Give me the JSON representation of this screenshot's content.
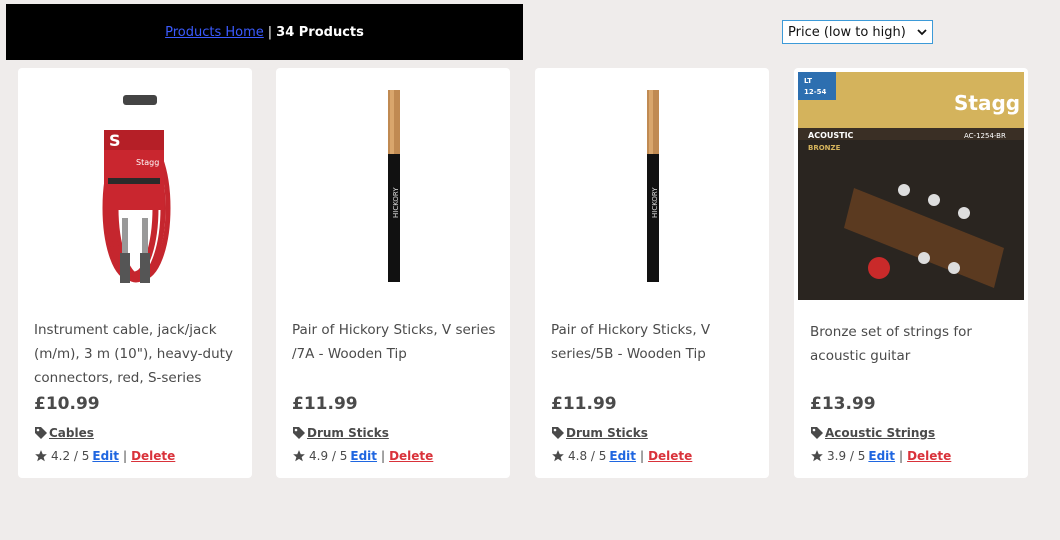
{
  "header": {
    "home_link": "Products Home",
    "separator": "|",
    "count_label": "34 Products"
  },
  "sort": {
    "selected": "Price (low to high)"
  },
  "products": [
    {
      "title": "Instrument cable, jack/jack (m/m), 3 m (10\"), heavy-duty connectors, red, S-series",
      "price": "£10.99",
      "category": "Cables",
      "rating": "4.2 / 5",
      "edit": "Edit",
      "sep": "|",
      "delete": "Delete",
      "image_icon": "red-cable-image"
    },
    {
      "title": "Pair of Hickory Sticks, V series /7A - Wooden Tip",
      "price": "£11.99",
      "category": "Drum Sticks",
      "rating": "4.9 / 5",
      "edit": "Edit",
      "sep": "|",
      "delete": "Delete",
      "image_icon": "drumstick-image"
    },
    {
      "title": "Pair of Hickory Sticks, V series/5B - Wooden Tip",
      "price": "£11.99",
      "category": "Drum Sticks",
      "rating": "4.8 / 5",
      "edit": "Edit",
      "sep": "|",
      "delete": "Delete",
      "image_icon": "drumstick-image"
    },
    {
      "title": "Bronze set of strings for acoustic guitar",
      "price": "£13.99",
      "category": "Acoustic Strings",
      "rating": "3.9 / 5",
      "edit": "Edit",
      "sep": "|",
      "delete": "Delete",
      "image_icon": "guitar-strings-pack-image",
      "pack": {
        "gauge_top": "LT",
        "gauge_bottom": "12-54",
        "brand": "Stagg",
        "type": "ACOUSTIC",
        "model": "AC-1254-BR",
        "material": "BRONZE"
      }
    }
  ],
  "colors": {
    "background": "#efeceb",
    "link": "#1f66e0",
    "delete": "#d9323a",
    "header_link": "#3b5bff"
  }
}
